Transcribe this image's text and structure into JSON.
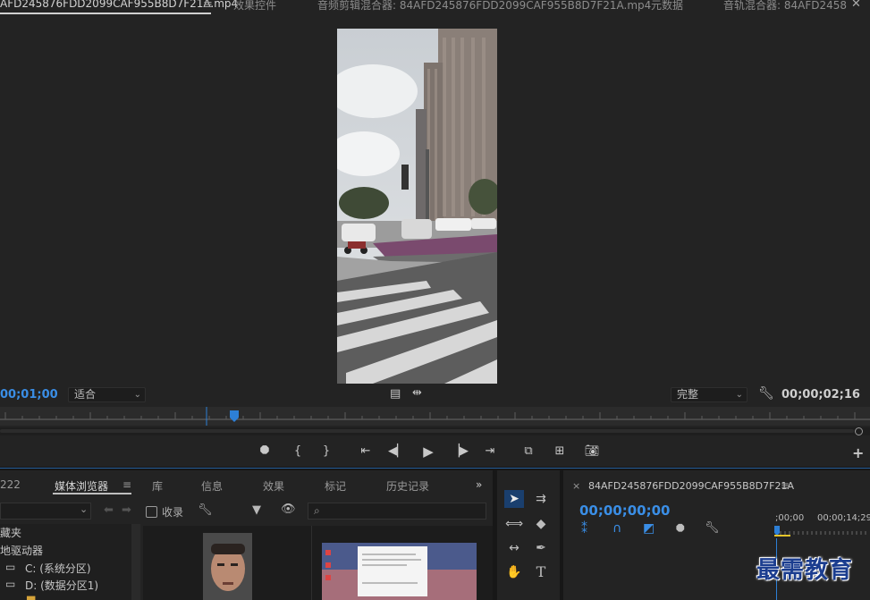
{
  "tabs": [
    {
      "label": "AFD245876FDD2099CAF955B8D7F21A.mp4",
      "active": true
    },
    {
      "label": "效果控件"
    },
    {
      "label": "音频剪辑混合器: 84AFD245876FDD2099CAF955B8D7F21A.mp4"
    },
    {
      "label": "元数据"
    },
    {
      "label": "音轨混合器: 84AFD2458"
    }
  ],
  "monitor": {
    "timecode_current": "00;01;00",
    "fit_select": "适合",
    "quality_select": "完整",
    "timecode_duration": "00;00;02;16"
  },
  "controls": [
    "marker-icon",
    "mark-in-icon",
    "mark-out-icon",
    "go-to-in-icon",
    "step-back-icon",
    "play-icon",
    "step-forward-icon",
    "go-to-out-icon",
    "insert-icon",
    "overwrite-icon",
    "export-frame-icon"
  ],
  "bottom_panel": {
    "left_stub": "222",
    "tabs": [
      "媒体浏览器",
      "库",
      "信息",
      "效果",
      "标记",
      "历史记录"
    ],
    "collect_label": "收录",
    "tree": {
      "header": "藏夹",
      "drives": "地驱动器",
      "c_drive": "C: (系统分区)",
      "d_drive": "D: (数据分区1)"
    }
  },
  "timeline": {
    "sequence_name": "84AFD245876FDD2099CAF955B8D7F21A",
    "timecode": "00;00;00;00",
    "ruler_start": ";00;00",
    "ruler_mark": "00;00;14;29"
  },
  "watermark": "最需教育",
  "colors": {
    "accent": "#3a8ee6",
    "playhead": "#2d7fd6",
    "background": "#232323"
  }
}
